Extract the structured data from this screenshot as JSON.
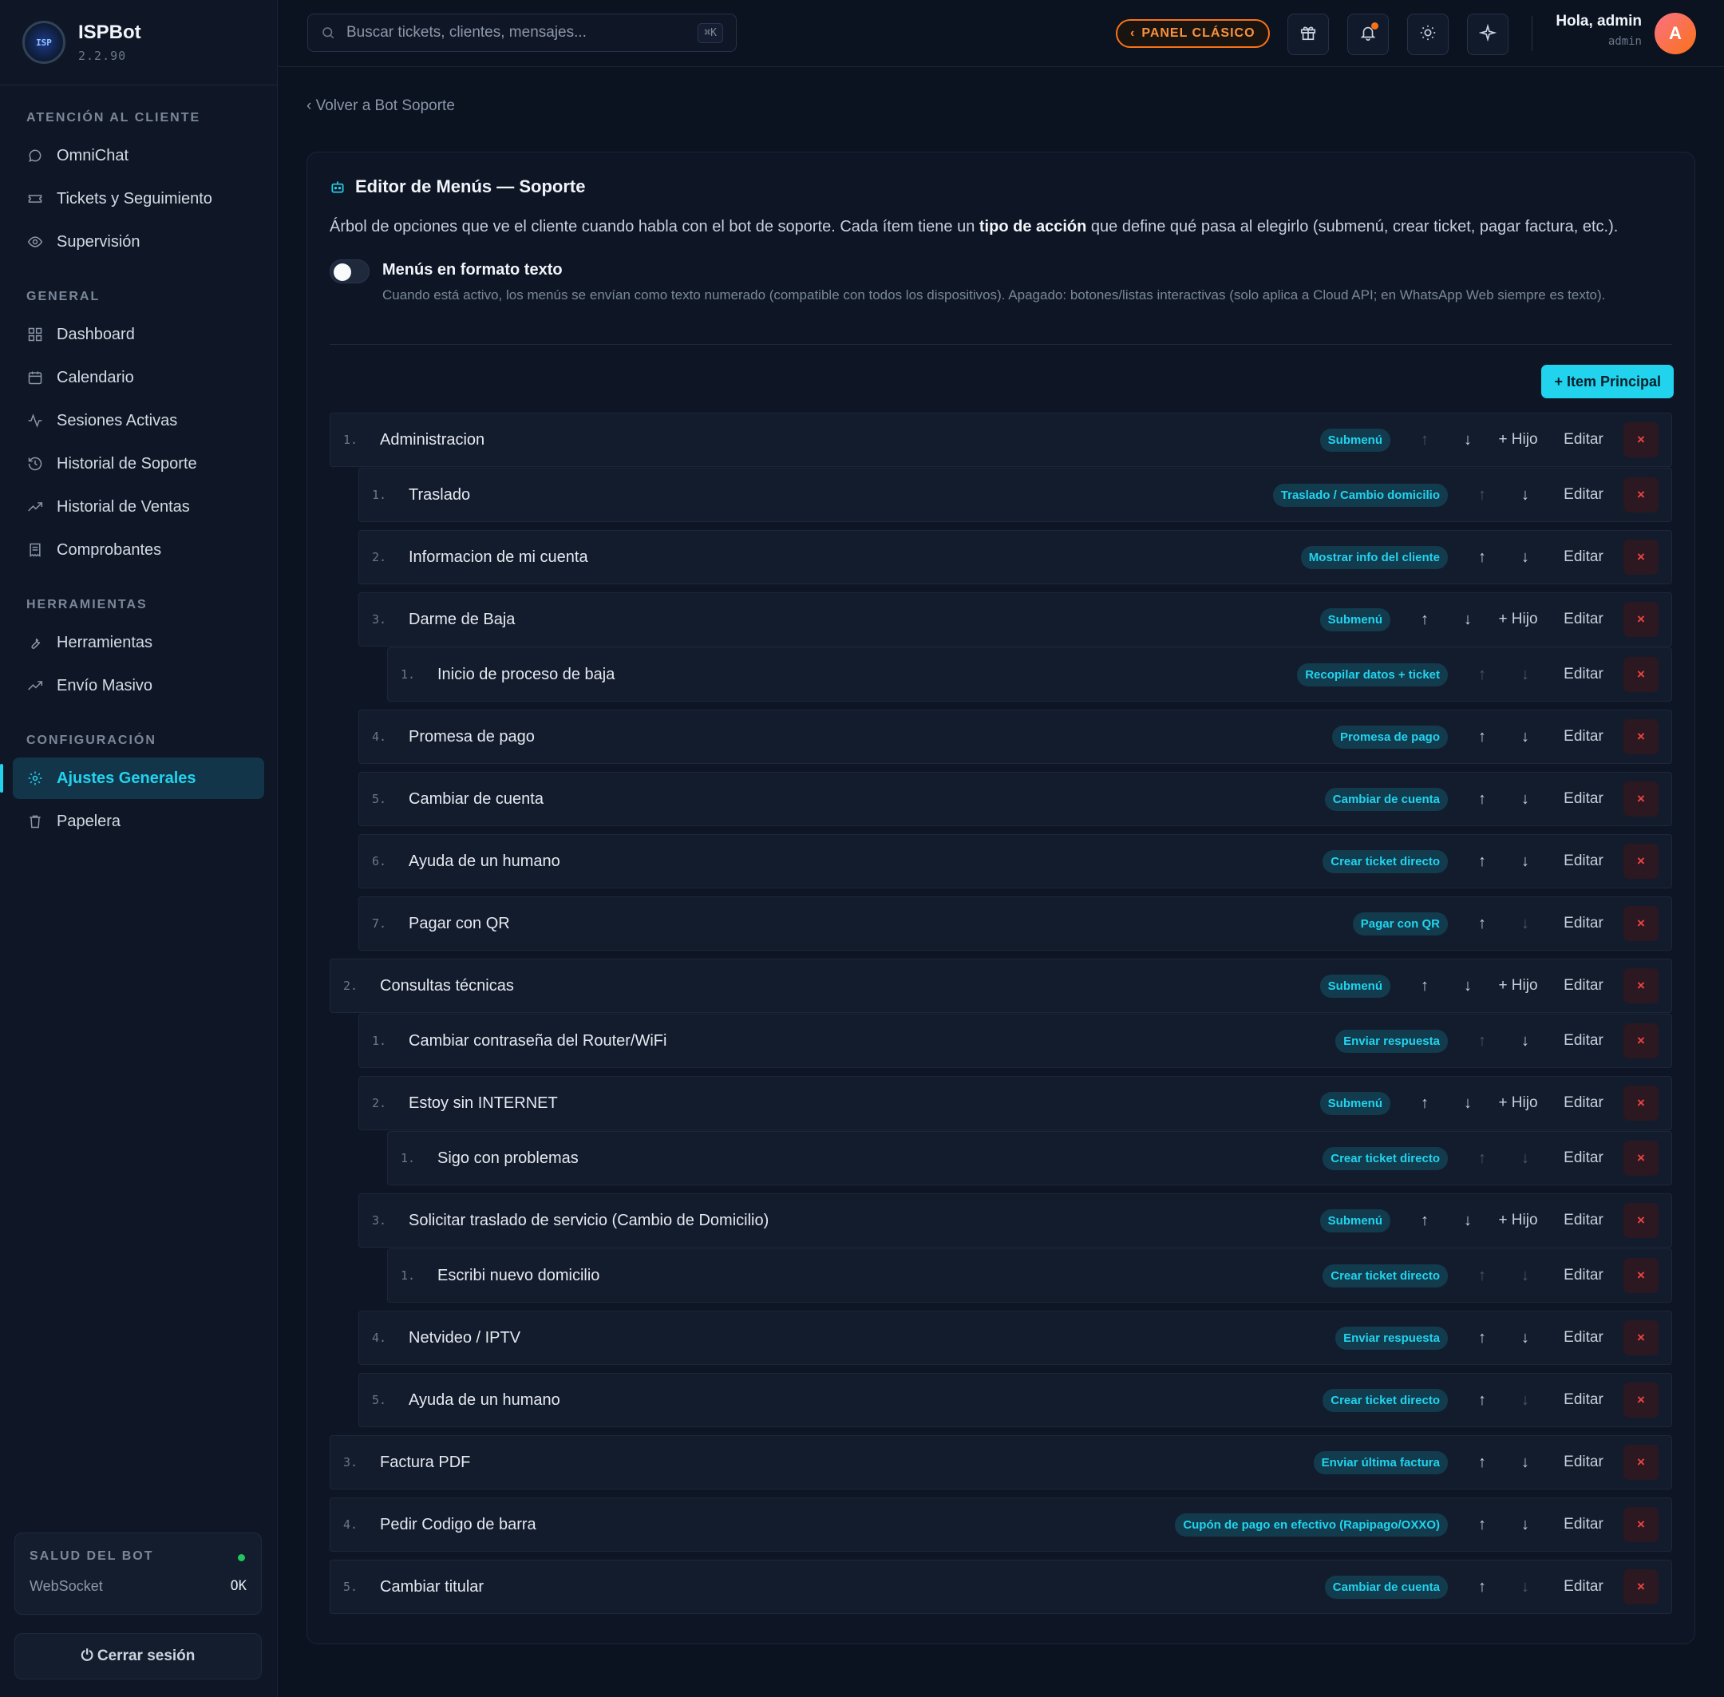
{
  "app": {
    "name": "ISPBot",
    "version": "2.2.90"
  },
  "sidebar": {
    "sections": [
      {
        "heading": "ATENCIÓN AL CLIENTE",
        "items": [
          {
            "label": "OmniChat",
            "icon": "chat-icon"
          },
          {
            "label": "Tickets y Seguimiento",
            "icon": "ticket-icon"
          },
          {
            "label": "Supervisión",
            "icon": "eye-icon"
          }
        ]
      },
      {
        "heading": "GENERAL",
        "items": [
          {
            "label": "Dashboard",
            "icon": "grid-icon"
          },
          {
            "label": "Calendario",
            "icon": "calendar-icon"
          },
          {
            "label": "Sesiones Activas",
            "icon": "activity-icon"
          },
          {
            "label": "Historial de Soporte",
            "icon": "history-icon"
          },
          {
            "label": "Historial de Ventas",
            "icon": "trending-up-icon"
          },
          {
            "label": "Comprobantes",
            "icon": "receipt-icon"
          }
        ]
      },
      {
        "heading": "HERRAMIENTAS",
        "items": [
          {
            "label": "Herramientas",
            "icon": "wrench-icon"
          },
          {
            "label": "Envío Masivo",
            "icon": "trending-up-icon"
          }
        ]
      },
      {
        "heading": "CONFIGURACIÓN",
        "items": [
          {
            "label": "Ajustes Generales",
            "icon": "gear-icon",
            "active": true
          },
          {
            "label": "Papelera",
            "icon": "trash-icon"
          }
        ]
      }
    ],
    "health": {
      "title": "SALUD DEL BOT",
      "row_label": "WebSocket",
      "row_value": "OK",
      "status_color": "#22c55e"
    },
    "logout_label": "⏻ Cerrar sesión"
  },
  "topbar": {
    "search_placeholder": "Buscar tickets, clientes, mensajes...",
    "search_shortcut": "⌘K",
    "panel_button": "PANEL CLÁSICO",
    "greeting": "Hola, admin",
    "role": "admin",
    "avatar_letter": "A"
  },
  "main": {
    "back_link": "‹ Volver a Bot Soporte",
    "title": "Editor de Menús — Soporte",
    "desc_before": "Árbol de opciones que ve el cliente cuando habla con el bot de soporte. Cada ítem tiene un ",
    "desc_bold": "tipo de acción",
    "desc_after": " que define qué pasa al elegirlo (submenú, crear ticket, pagar factura, etc.).",
    "toggle_label": "Menús en formato texto",
    "toggle_on": false,
    "toggle_help": "Cuando está activo, los menús se envían como texto numerado (compatible con todos los dispositivos). Apagado: botones/listas interactivas (solo aplica a Cloud API; en WhatsApp Web siempre es texto).",
    "add_main_label": "+ Item Principal",
    "labels": {
      "hijo": "+ Hijo",
      "edit": "Editar",
      "delete": "×",
      "up": "↑",
      "down": "↓"
    },
    "accent": "#22d3ee"
  },
  "menu_rows": [
    {
      "depth": 0,
      "num": "1.",
      "label": "Administracion",
      "badge": "Submenú",
      "up": false,
      "down": true,
      "hijo": true
    },
    {
      "depth": 1,
      "num": "1.",
      "label": "Traslado",
      "badge": "Traslado / Cambio domicilio",
      "up": false,
      "down": true,
      "hijo": false
    },
    {
      "depth": 1,
      "num": "2.",
      "label": "Informacion de mi cuenta",
      "badge": "Mostrar info del cliente",
      "up": true,
      "down": true,
      "hijo": false
    },
    {
      "depth": 1,
      "num": "3.",
      "label": "Darme de Baja",
      "badge": "Submenú",
      "up": true,
      "down": true,
      "hijo": true
    },
    {
      "depth": 2,
      "num": "1.",
      "label": "Inicio de proceso de baja",
      "badge": "Recopilar datos + ticket",
      "up": false,
      "down": false,
      "hijo": false
    },
    {
      "depth": 1,
      "num": "4.",
      "label": "Promesa de pago",
      "badge": "Promesa de pago",
      "up": true,
      "down": true,
      "hijo": false
    },
    {
      "depth": 1,
      "num": "5.",
      "label": "Cambiar de cuenta",
      "badge": "Cambiar de cuenta",
      "up": true,
      "down": true,
      "hijo": false
    },
    {
      "depth": 1,
      "num": "6.",
      "label": "Ayuda de un humano",
      "badge": "Crear ticket directo",
      "up": true,
      "down": true,
      "hijo": false
    },
    {
      "depth": 1,
      "num": "7.",
      "label": "Pagar con QR",
      "badge": "Pagar con QR",
      "up": true,
      "down": false,
      "hijo": false
    },
    {
      "depth": 0,
      "num": "2.",
      "label": "Consultas técnicas",
      "badge": "Submenú",
      "up": true,
      "down": true,
      "hijo": true
    },
    {
      "depth": 1,
      "num": "1.",
      "label": "Cambiar contraseña del Router/WiFi",
      "badge": "Enviar respuesta",
      "up": false,
      "down": true,
      "hijo": false
    },
    {
      "depth": 1,
      "num": "2.",
      "label": "Estoy sin INTERNET",
      "badge": "Submenú",
      "up": true,
      "down": true,
      "hijo": true
    },
    {
      "depth": 2,
      "num": "1.",
      "label": "Sigo con problemas",
      "badge": "Crear ticket directo",
      "up": false,
      "down": false,
      "hijo": false
    },
    {
      "depth": 1,
      "num": "3.",
      "label": "Solicitar traslado de servicio (Cambio de Domicilio)",
      "badge": "Submenú",
      "up": true,
      "down": true,
      "hijo": true
    },
    {
      "depth": 2,
      "num": "1.",
      "label": "Escribi nuevo domicilio",
      "badge": "Crear ticket directo",
      "up": false,
      "down": false,
      "hijo": false
    },
    {
      "depth": 1,
      "num": "4.",
      "label": "Netvideo / IPTV",
      "badge": "Enviar respuesta",
      "up": true,
      "down": true,
      "hijo": false
    },
    {
      "depth": 1,
      "num": "5.",
      "label": "Ayuda de un humano",
      "badge": "Crear ticket directo",
      "up": true,
      "down": false,
      "hijo": false
    },
    {
      "depth": 0,
      "num": "3.",
      "label": "Factura PDF",
      "badge": "Enviar última factura",
      "up": true,
      "down": true,
      "hijo": false
    },
    {
      "depth": 0,
      "num": "4.",
      "label": "Pedir Codigo de barra",
      "badge": "Cupón de pago en efectivo (Rapipago/OXXO)",
      "up": true,
      "down": true,
      "hijo": false
    },
    {
      "depth": 0,
      "num": "5.",
      "label": "Cambiar titular",
      "badge": "Cambiar de cuenta",
      "up": true,
      "down": false,
      "hijo": false
    }
  ]
}
